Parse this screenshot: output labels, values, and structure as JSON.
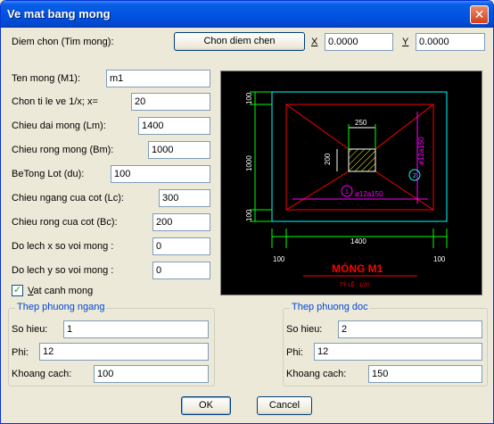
{
  "window": {
    "title": "Ve mat bang mong",
    "close_glyph": "✕"
  },
  "point": {
    "label": "Diem chon (Tim mong):",
    "button": "Chon diem chen",
    "x_label": "X",
    "x_value": "0.0000",
    "y_label": "Y",
    "y_value": "0.0000"
  },
  "fields": {
    "ten_mong": {
      "label": "Ten mong (M1):",
      "value": "m1"
    },
    "ti_le": {
      "label": "Chon ti le ve 1/x; x=",
      "value": "20"
    },
    "chieu_dai": {
      "label": "Chieu dai mong (Lm):",
      "value": "1400"
    },
    "chieu_rong": {
      "label": "Chieu rong mong (Bm):",
      "value": "1000"
    },
    "betong_lot": {
      "label": "BeTong Lot (du):",
      "value": "100"
    },
    "cot_ngang": {
      "label": "Chieu ngang cua cot (Lc):",
      "value": "300"
    },
    "cot_rong": {
      "label": "Chieu rong cua cot (Bc):",
      "value": "200"
    },
    "lech_x": {
      "label": "Do lech x so voi mong :",
      "value": "0"
    },
    "lech_y": {
      "label": "Do lech y so voi mong :",
      "value": "0"
    }
  },
  "vat_canh": {
    "label": "Vat canh mong",
    "checked": true
  },
  "preview": {
    "dim_250": "250",
    "dim_1000": "1000",
    "dim_100_top": "100",
    "dim_200": "200",
    "dim_100_bot": "100",
    "dim_1400": "1400",
    "dim_100_left": "100",
    "dim_100_right": "100",
    "rebar_right": "ø12a150",
    "rebar_bottom": "ø12a150",
    "marker_1": "1",
    "marker_2": "2",
    "title": "MÓNG M1",
    "scale": "TỶ LỆ : 1/20"
  },
  "thep_ngang": {
    "title": "Thep phuong ngang",
    "so_hieu": {
      "label": "So hieu:",
      "value": "1"
    },
    "phi": {
      "label": "Phi:",
      "value": "12"
    },
    "khoang_cach": {
      "label": "Khoang cach:",
      "value": "100"
    }
  },
  "thep_doc": {
    "title": "Thep phuong doc",
    "so_hieu": {
      "label": "So hieu:",
      "value": "2"
    },
    "phi": {
      "label": "Phi:",
      "value": "12"
    },
    "khoang_cach": {
      "label": "Khoang cach:",
      "value": "150"
    }
  },
  "buttons": {
    "ok": "OK",
    "cancel": "Cancel"
  }
}
